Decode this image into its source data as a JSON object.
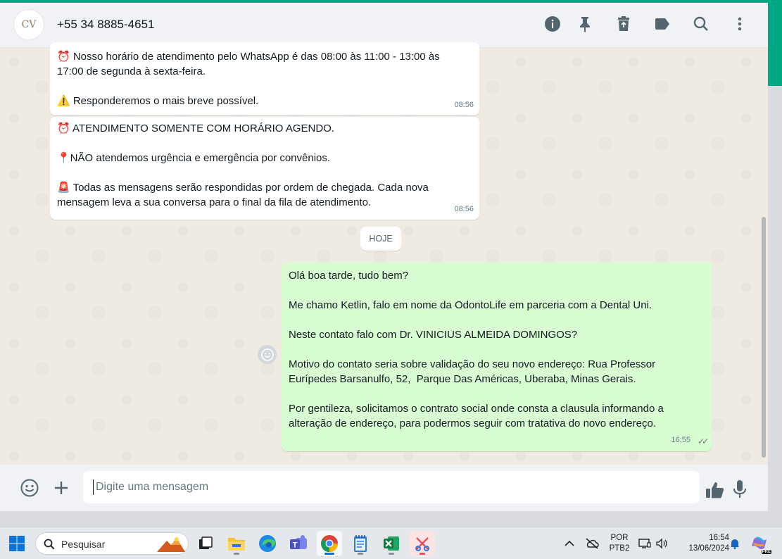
{
  "header": {
    "avatar_text": "CV",
    "contact_name": "+55 34 8885-4651",
    "icons": [
      "info-icon",
      "pin-icon",
      "trash-icon",
      "label-icon",
      "search-icon",
      "menu-dots-icon"
    ]
  },
  "messages": {
    "m1_text": "⏰ Nosso horário de atendimento pelo WhatsApp é das 08:00 às 11:00 - 13:00 às 17:00 de segunda à sexta-feira.\n\n⚠️ Responderemos o mais breve possível.",
    "m1_time": "08:56",
    "m2_text": "⏰ ATENDIMENTO SOMENTE COM HORÁRIO AGENDO.\n\n📍NÃO atendemos urgência e emergência por convênios.\n\n🚨 Todas as mensagens serão respondidas por ordem de chegada. Cada nova mensagem leva a sua conversa para o final da fila de atendimento.",
    "m2_time": "08:56",
    "date_chip": "HOJE",
    "m3_text": "Olá boa tarde, tudo bem?\n\nMe chamo Ketlin, falo em nome da OdontoLife em parceria com a Dental Uni.\n\nNeste contato falo com Dr. VINICIUS ALMEIDA DOMINGOS?\n\nMotivo do contato seria sobre validação do seu novo endereço: Rua Professor Eurípedes Barsanulfo, 52,  Parque Das Américas, Uberaba, Minas Gerais.\n\nPor gentileza, solicitamos o contrato social onde consta a clausula informando a alteração de endereço, para podermos seguir com tratativa do novo endereço.",
    "m3_time": "16:55",
    "m3_status": "✓✓"
  },
  "composer": {
    "placeholder": "Digite uma mensagem"
  },
  "taskbar": {
    "search_label": "Pesquisar",
    "lang_top": "POR",
    "lang_bottom": "PTB2",
    "clock_time": "16:54",
    "clock_date": "13/06/2024",
    "copilot_badge": "PRE"
  },
  "colors": {
    "accent": "#00a884",
    "outgoing_bubble": "#d9fdd3",
    "incoming_bubble": "#ffffff",
    "chat_bg": "#efeae2"
  }
}
